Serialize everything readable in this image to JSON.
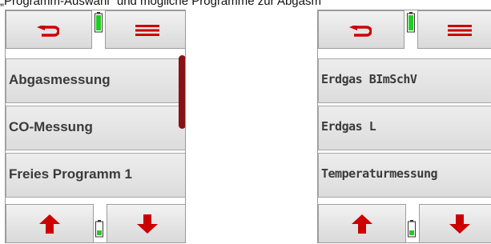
{
  "caption": "„Programm-Auswahl“ und mögliche Programme zur Abgasmessung",
  "left_screen": {
    "nav": {
      "back_icon": "return-arrow-icon",
      "menu_icon": "hamburger-menu-icon",
      "up_icon": "arrow-up-icon",
      "down_icon": "arrow-down-icon"
    },
    "battery_level_top": 1.0,
    "battery_level_bottom": 0.3,
    "items": [
      "Abgasmessung",
      "CO-Messung",
      "Freies Programm 1"
    ]
  },
  "right_screen": {
    "nav": {
      "back_icon": "return-arrow-icon",
      "menu_icon": "hamburger-menu-icon",
      "up_icon": "arrow-up-icon",
      "down_icon": "arrow-down-icon"
    },
    "battery_level_top": 1.0,
    "battery_level_bottom": 0.3,
    "items": [
      "Erdgas BImSchV",
      "Erdgas L",
      "Temperaturmessung"
    ]
  },
  "colors": {
    "icon_red": "#cc0000",
    "scrollbar": "#8a1212",
    "battery_green": "#22cc22",
    "button_gray": "#e2e2e2"
  }
}
